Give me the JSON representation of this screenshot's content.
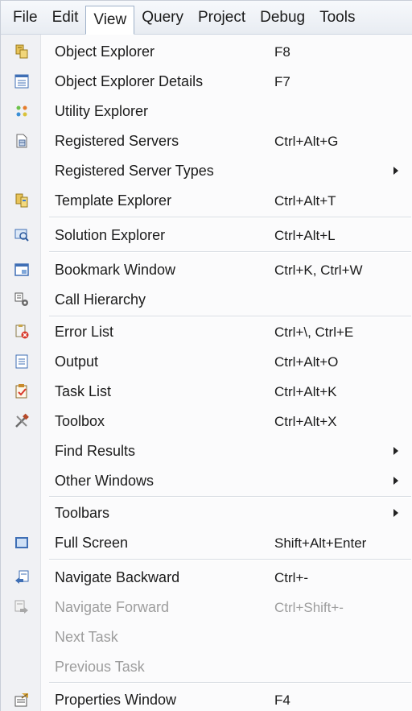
{
  "menubar": {
    "items": [
      {
        "label": "File",
        "active": false
      },
      {
        "label": "Edit",
        "active": false
      },
      {
        "label": "View",
        "active": true
      },
      {
        "label": "Query",
        "active": false
      },
      {
        "label": "Project",
        "active": false
      },
      {
        "label": "Debug",
        "active": false
      },
      {
        "label": "Tools",
        "active": false
      }
    ]
  },
  "menu": {
    "items": [
      {
        "label": "Object Explorer",
        "shortcut": "F8",
        "icon": "object-explorer-icon",
        "submenu": false,
        "disabled": false
      },
      {
        "label": "Object Explorer Details",
        "shortcut": "F7",
        "icon": "details-grid-icon",
        "submenu": false,
        "disabled": false
      },
      {
        "label": "Utility Explorer",
        "shortcut": "",
        "icon": "utility-explorer-icon",
        "submenu": false,
        "disabled": false
      },
      {
        "label": "Registered Servers",
        "shortcut": "Ctrl+Alt+G",
        "icon": "registered-servers-icon",
        "submenu": false,
        "disabled": false
      },
      {
        "label": "Registered Server Types",
        "shortcut": "",
        "icon": "",
        "submenu": true,
        "disabled": false
      },
      {
        "label": "Template Explorer",
        "shortcut": "Ctrl+Alt+T",
        "icon": "template-explorer-icon",
        "submenu": false,
        "disabled": false
      },
      {
        "label": "Solution Explorer",
        "shortcut": "Ctrl+Alt+L",
        "icon": "solution-explorer-icon",
        "submenu": false,
        "disabled": false
      },
      {
        "label": "Bookmark Window",
        "shortcut": "Ctrl+K, Ctrl+W",
        "icon": "bookmark-window-icon",
        "submenu": false,
        "disabled": false
      },
      {
        "label": "Call Hierarchy",
        "shortcut": "",
        "icon": "call-hierarchy-icon",
        "submenu": false,
        "disabled": false
      },
      {
        "label": "Error List",
        "shortcut": "Ctrl+\\, Ctrl+E",
        "icon": "error-list-icon",
        "submenu": false,
        "disabled": false
      },
      {
        "label": "Output",
        "shortcut": "Ctrl+Alt+O",
        "icon": "output-icon",
        "submenu": false,
        "disabled": false
      },
      {
        "label": "Task List",
        "shortcut": "Ctrl+Alt+K",
        "icon": "task-list-icon",
        "submenu": false,
        "disabled": false
      },
      {
        "label": "Toolbox",
        "shortcut": "Ctrl+Alt+X",
        "icon": "toolbox-icon",
        "submenu": false,
        "disabled": false
      },
      {
        "label": "Find Results",
        "shortcut": "",
        "icon": "",
        "submenu": true,
        "disabled": false
      },
      {
        "label": "Other Windows",
        "shortcut": "",
        "icon": "",
        "submenu": true,
        "disabled": false
      },
      {
        "label": "Toolbars",
        "shortcut": "",
        "icon": "",
        "submenu": true,
        "disabled": false
      },
      {
        "label": "Full Screen",
        "shortcut": "Shift+Alt+Enter",
        "icon": "full-screen-icon",
        "submenu": false,
        "disabled": false
      },
      {
        "label": "Navigate Backward",
        "shortcut": "Ctrl+-",
        "icon": "navigate-backward-icon",
        "submenu": false,
        "disabled": false
      },
      {
        "label": "Navigate Forward",
        "shortcut": "Ctrl+Shift+-",
        "icon": "navigate-forward-icon",
        "submenu": false,
        "disabled": true
      },
      {
        "label": "Next Task",
        "shortcut": "",
        "icon": "",
        "submenu": false,
        "disabled": true
      },
      {
        "label": "Previous Task",
        "shortcut": "",
        "icon": "",
        "submenu": false,
        "disabled": true
      },
      {
        "label": "Properties Window",
        "shortcut": "F4",
        "icon": "properties-window-icon",
        "submenu": false,
        "disabled": false
      }
    ]
  }
}
